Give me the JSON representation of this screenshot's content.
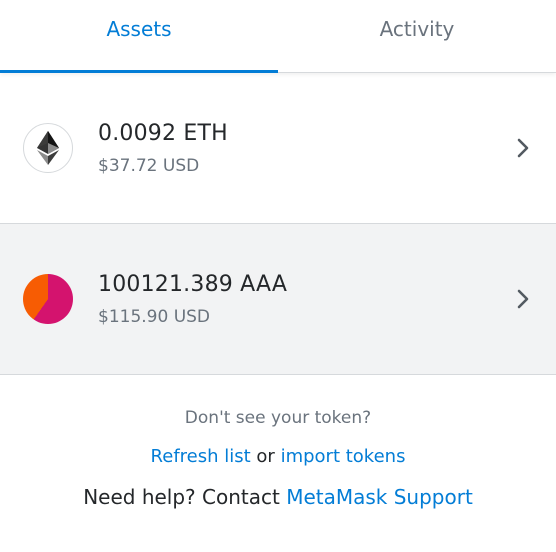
{
  "tabs": [
    {
      "label": "Assets",
      "active": true
    },
    {
      "label": "Activity",
      "active": false
    }
  ],
  "assets": [
    {
      "amount": "0.0092 ETH",
      "fiat": "$37.72 USD",
      "icon": "ethereum-icon"
    },
    {
      "amount": "100121.389 AAA",
      "fiat": "$115.90 USD",
      "icon": "token-avatar-icon"
    }
  ],
  "footer": {
    "prompt": "Don't see your token?",
    "refresh_link": "Refresh list",
    "or_text": "or",
    "import_link": "import tokens",
    "help_text": "Need help? Contact",
    "support_link": "MetaMask Support"
  },
  "colors": {
    "accent": "#037dd6",
    "text_primary": "#24272a",
    "text_secondary": "#6a737d",
    "selected_row_bg": "#f2f3f4"
  }
}
